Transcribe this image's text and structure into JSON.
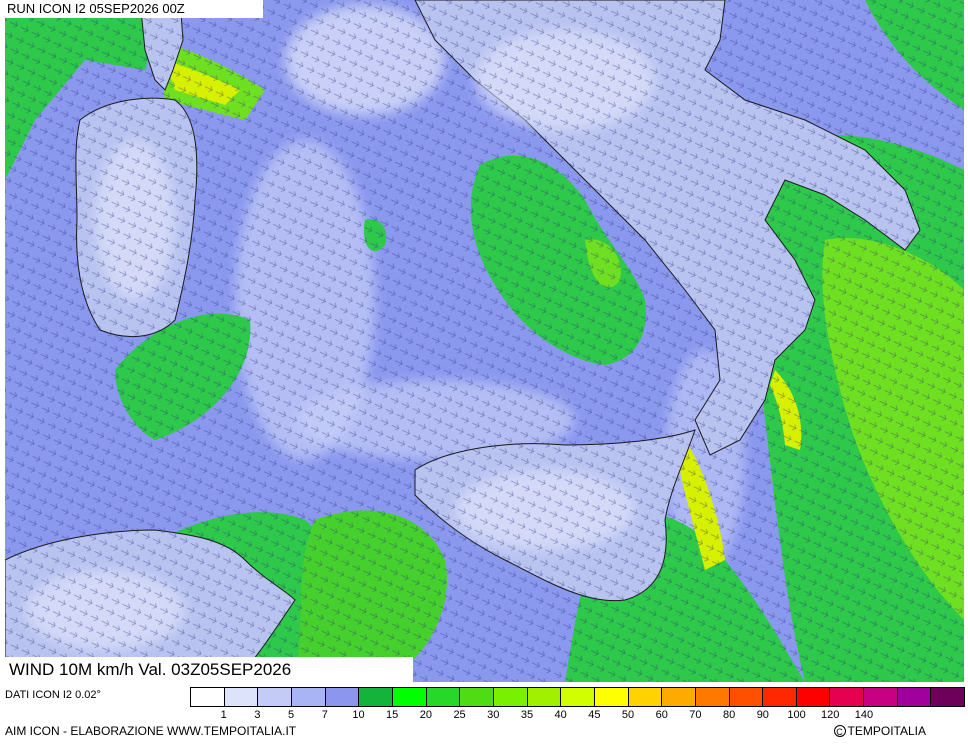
{
  "header": {
    "run_title": "RUN ICON I2 05SEP2026 00Z"
  },
  "footer": {
    "variable_title": "WIND 10M km/h Val. 03Z05SEP2026",
    "data_source": "DATI ICON I2 0.02°",
    "credit_left": "AIM ICON - ELABORAZIONE WWW.TEMPOITALIA.IT",
    "credit_right": "TEMPOITALIA",
    "copyright_symbol": "C"
  },
  "legend": {
    "colors": [
      "#ffffff",
      "#dde3fb",
      "#c3ccf6",
      "#a8b4f3",
      "#8c96ee",
      "#14b43c",
      "#00ff00",
      "#28d828",
      "#50dc14",
      "#78f000",
      "#a0f000",
      "#d2ff00",
      "#ffff00",
      "#ffd200",
      "#ffaa00",
      "#ff7800",
      "#ff5000",
      "#ff2800",
      "#ff0000",
      "#e60050",
      "#c80082",
      "#a0009b",
      "#6e005a"
    ],
    "ticks": [
      "1",
      "3",
      "5",
      "7",
      "10",
      "15",
      "20",
      "25",
      "30",
      "35",
      "40",
      "45",
      "50",
      "60",
      "70",
      "80",
      "90",
      "100",
      "120",
      "140"
    ]
  },
  "map": {
    "sea_color": "#8a98ee",
    "land_color": "#b8c3f0",
    "calm_color": "#e4e8fb",
    "moderate_color": "#2ec84a",
    "strong_color": "#6fe021",
    "gust_color": "#d7f000",
    "coast_color": "#1a1a1a",
    "arrow_color": "#2a2e7a",
    "icons": [
      "wind-vector-icon",
      "coastline-icon"
    ]
  }
}
